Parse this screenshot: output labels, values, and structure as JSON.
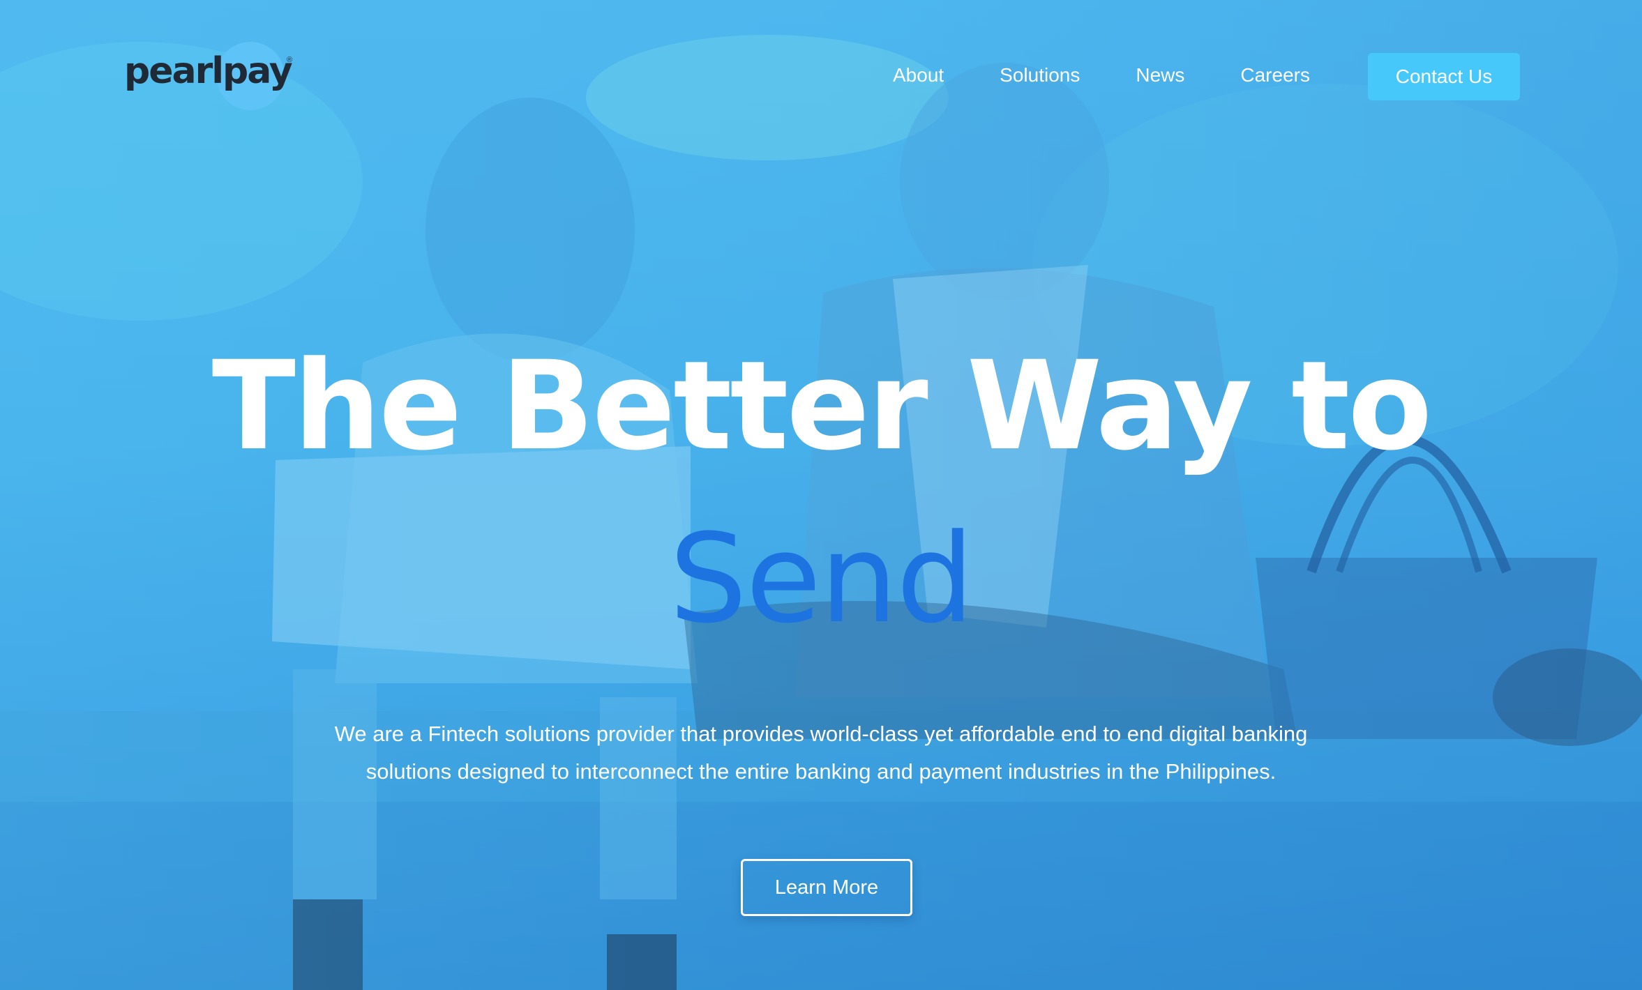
{
  "brand": {
    "logo_text": "pearlpay",
    "logo_mark": "®",
    "accent_color": "#47c8fb",
    "highlight_color": "#1d74e0"
  },
  "nav": {
    "items": [
      {
        "label": "About"
      },
      {
        "label": "Solutions"
      },
      {
        "label": "News"
      },
      {
        "label": "Careers"
      }
    ],
    "cta_label": "Contact Us"
  },
  "hero": {
    "headline": "The Better Way to",
    "headline_accent": "Send",
    "subtitle_line1": "We are a Fintech solutions provider that provides world-class yet affordable end to end digital banking",
    "subtitle_line2": "solutions designed to interconnect the entire banking and payment industries in the Philippines.",
    "button_label": "Learn More",
    "background_image": "boy-and-grandmother-photo"
  }
}
